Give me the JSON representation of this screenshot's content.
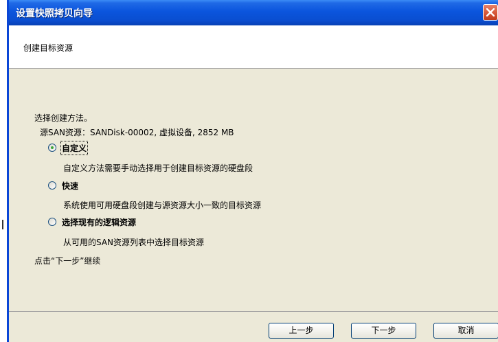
{
  "window": {
    "title": "设置快照拷贝向导",
    "close_icon": "close-icon"
  },
  "header": {
    "title": "创建目标资源"
  },
  "content": {
    "prompt": "选择创建方法。",
    "source_info": "源SAN资源：SANDisk-00002, 虚拟设备, 2852 MB",
    "options": [
      {
        "label": "自定义",
        "description": "自定义方法需要手动选择用于创建目标资源的硬盘段",
        "selected": true
      },
      {
        "label": "快速",
        "description": "系统使用可用硬盘段创建与源资源大小一致的目标资源",
        "selected": false
      },
      {
        "label": "选择现有的逻辑资源",
        "description": "从可用的SAN资源列表中选择目标资源",
        "selected": false
      }
    ],
    "hint": "点击“下一步”继续"
  },
  "buttons": {
    "back": "上一步",
    "next": "下一步",
    "cancel": "取消"
  },
  "colors": {
    "titlebar": "#0a4ed0",
    "dialog_bg": "#ece9d8",
    "radio_dot": "#3da43a",
    "close_button": "#d85a3c"
  }
}
